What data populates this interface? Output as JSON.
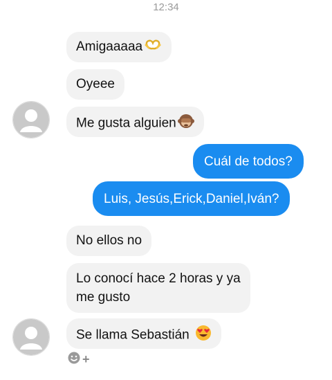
{
  "chat": {
    "timestamp": "12:34",
    "messages": [
      {
        "direction": "received",
        "text": "Amigaaaaa",
        "emoji": "heart-hands-emoji"
      },
      {
        "direction": "received",
        "text": "Oyeee"
      },
      {
        "direction": "received",
        "text": "Me gusta alguien",
        "emoji": "see-no-evil-monkey-emoji"
      },
      {
        "direction": "sent",
        "text": "Cuál de todos?"
      },
      {
        "direction": "sent",
        "text": "Luis, Jesús,Erick,Daniel,Iván?"
      },
      {
        "direction": "received",
        "text": "No ellos no"
      },
      {
        "direction": "received",
        "line1": "Lo conocí hace 2 horas y ya",
        "line2": "me gusto"
      },
      {
        "direction": "received",
        "text": "Se llama Sebastián",
        "emoji": "heart-eyes-emoji"
      }
    ],
    "bottom_icons": [
      "smiley-icon",
      "plus-icon"
    ],
    "colors": {
      "sent_bubble": "#1a8cf0",
      "received_bubble": "#f2f2f2",
      "background": "#ffffff"
    }
  }
}
